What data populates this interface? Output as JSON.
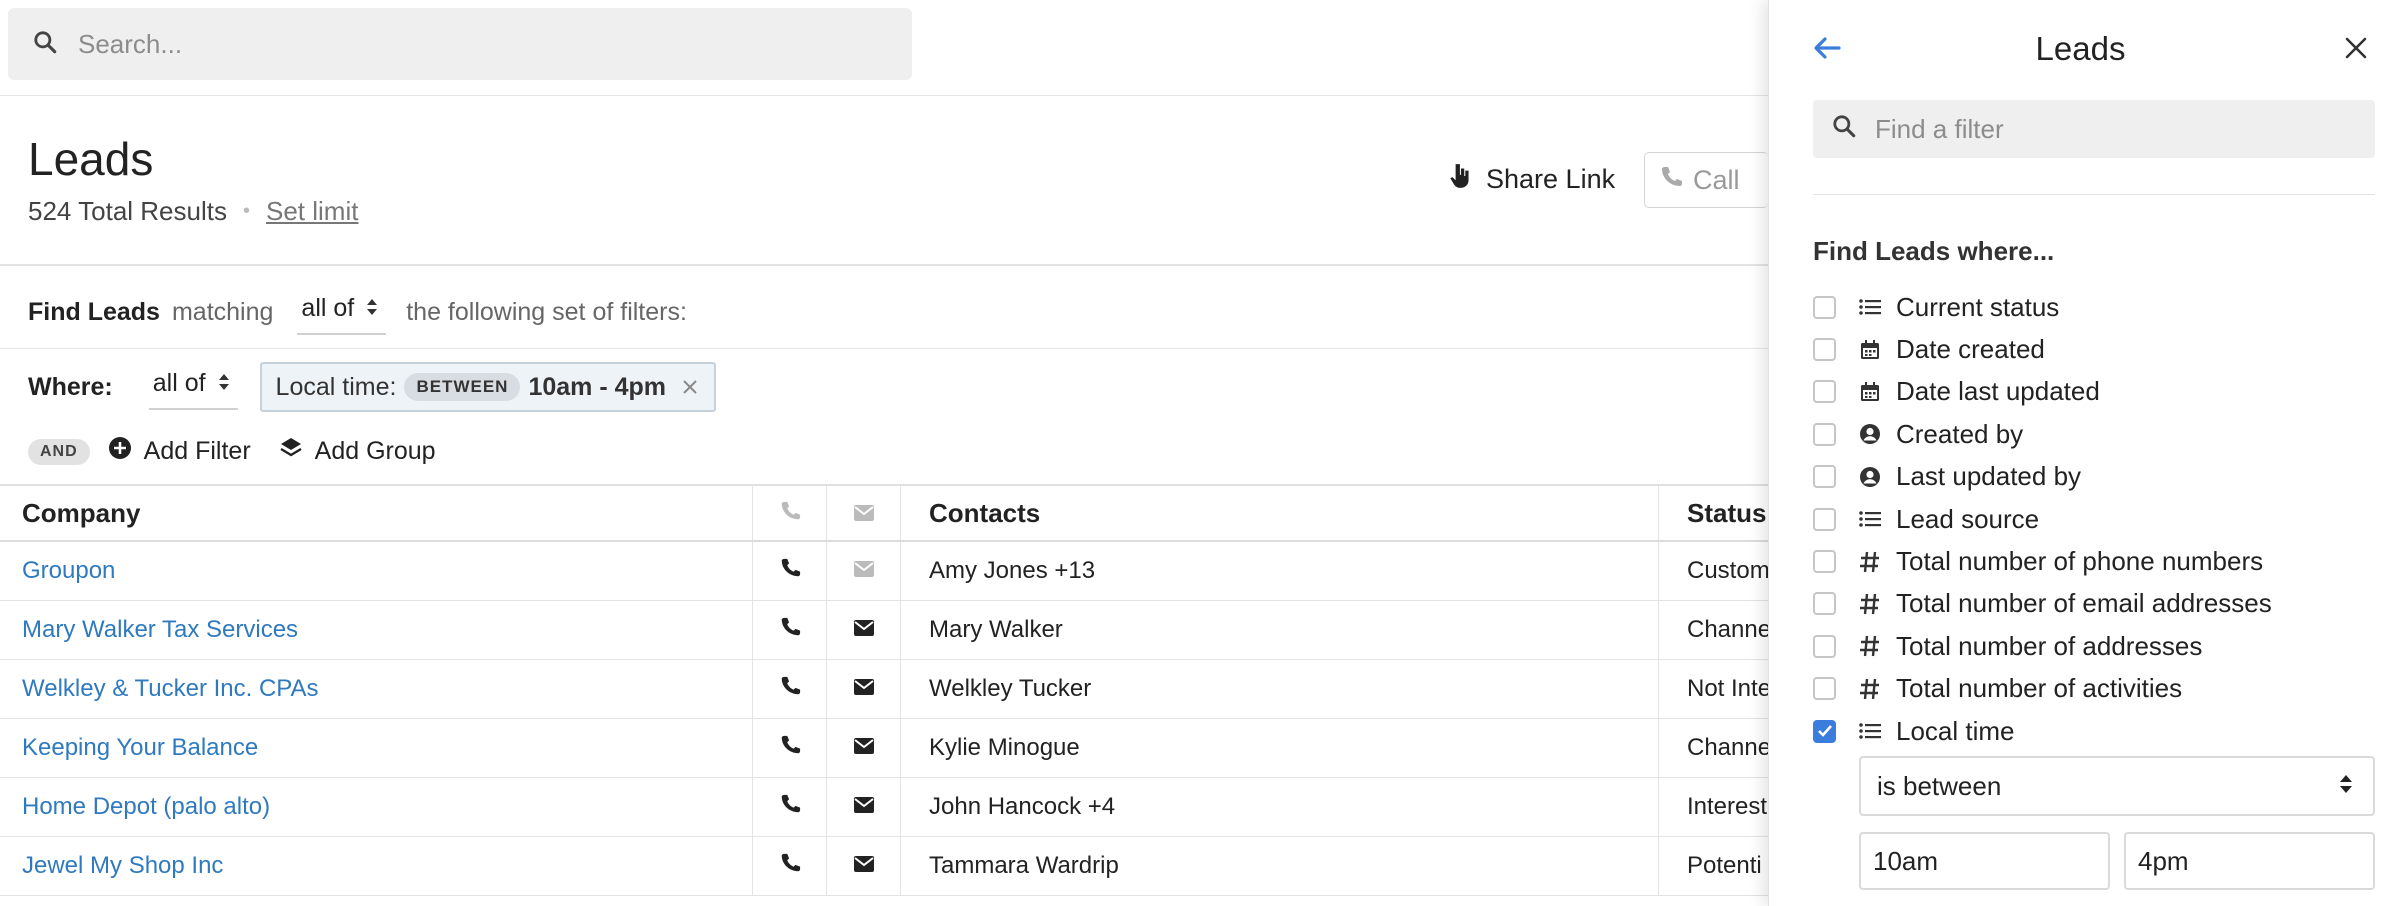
{
  "search": {
    "placeholder": "Search..."
  },
  "header": {
    "title": "Leads",
    "total_results": "524 Total Results",
    "set_limit": "Set limit",
    "share_link": "Share Link",
    "call_label": "Call"
  },
  "filters": {
    "find_label": "Find Leads",
    "matching": "matching",
    "match_mode": "all of",
    "following": "the following set of filters:",
    "where_label": "Where:",
    "where_mode": "all of",
    "chip_field": "Local time:",
    "chip_operator": "BETWEEN",
    "chip_value": "10am - 4pm",
    "and_label": "AND",
    "add_filter": "Add Filter",
    "add_group": "Add Group"
  },
  "table": {
    "columns": {
      "company": "Company",
      "contacts": "Contacts",
      "status": "Status"
    },
    "rows": [
      {
        "company": "Groupon",
        "contacts": "Amy Jones +13",
        "status": "Custom",
        "has_email": false
      },
      {
        "company": "Mary Walker Tax Services",
        "contacts": "Mary Walker",
        "status": "Channe",
        "has_email": true
      },
      {
        "company": "Welkley & Tucker Inc. CPAs",
        "contacts": "Welkley Tucker",
        "status": "Not Inte",
        "has_email": true
      },
      {
        "company": "Keeping Your Balance",
        "contacts": "Kylie Minogue",
        "status": "Channe",
        "has_email": true
      },
      {
        "company": "Home Depot (palo alto)",
        "contacts": "John Hancock +4",
        "status": "Interest",
        "has_email": true
      },
      {
        "company": "Jewel My Shop Inc",
        "contacts": "Tammara Wardrip",
        "status": "Potenti",
        "has_email": true
      }
    ]
  },
  "panel": {
    "title": "Leads",
    "search_placeholder": "Find a filter",
    "find_where": "Find Leads where...",
    "filters": [
      {
        "label": "Current status",
        "icon": "list-icon",
        "checked": false
      },
      {
        "label": "Date created",
        "icon": "calendar-icon",
        "checked": false
      },
      {
        "label": "Date last updated",
        "icon": "calendar-icon",
        "checked": false
      },
      {
        "label": "Created by",
        "icon": "user-circle-icon",
        "checked": false
      },
      {
        "label": "Last updated by",
        "icon": "user-circle-icon",
        "checked": false
      },
      {
        "label": "Lead source",
        "icon": "list-icon",
        "checked": false
      },
      {
        "label": "Total number of phone numbers",
        "icon": "hash-icon",
        "checked": false
      },
      {
        "label": "Total number of email addresses",
        "icon": "hash-icon",
        "checked": false
      },
      {
        "label": "Total number of addresses",
        "icon": "hash-icon",
        "checked": false
      },
      {
        "label": "Total number of activities",
        "icon": "hash-icon",
        "checked": false
      },
      {
        "label": "Local time",
        "icon": "list-icon",
        "checked": true
      }
    ],
    "condition": "is between",
    "value_from": "10am",
    "value_to": "4pm"
  },
  "colors": {
    "link": "#2f7abf",
    "checkbox_on": "#3b7ddd",
    "back_arrow": "#3b7ddd"
  }
}
